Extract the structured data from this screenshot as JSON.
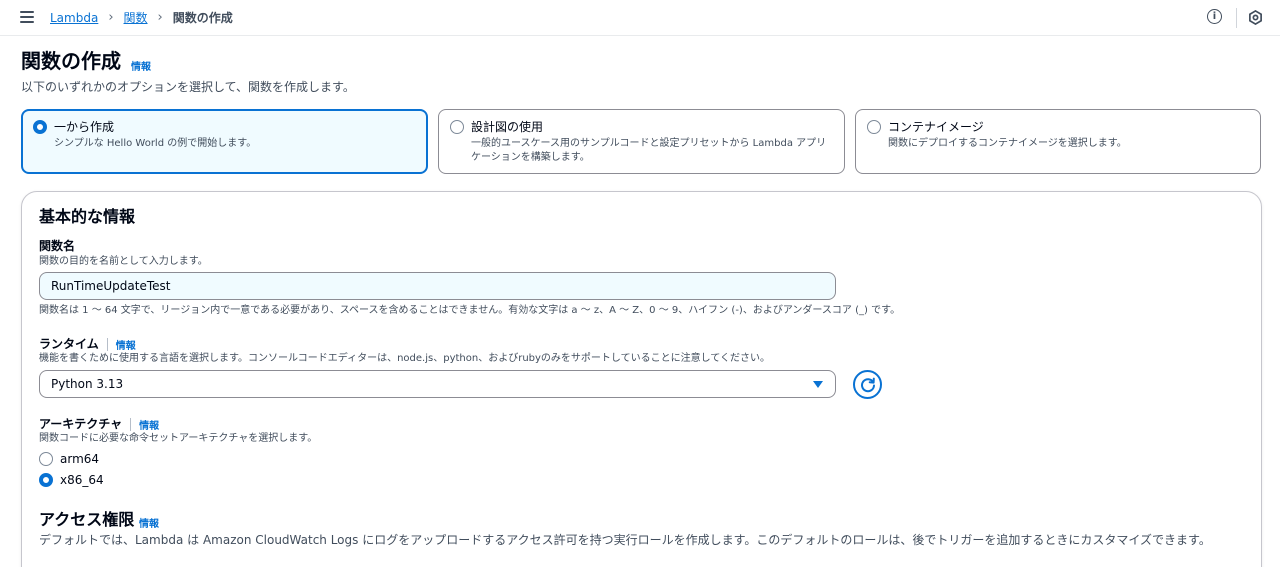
{
  "breadcrumb": {
    "items": [
      "Lambda",
      "関数"
    ],
    "current": "関数の作成"
  },
  "header": {
    "title": "関数の作成",
    "info": "情報",
    "description": "以下のいずれかのオプションを選択して、関数を作成します。"
  },
  "options": [
    {
      "title": "一から作成",
      "description": "シンプルな Hello World の例で開始します。",
      "selected": true
    },
    {
      "title": "設計図の使用",
      "description": "一般的ユースケース用のサンプルコードと設定プリセットから Lambda アプリケーションを構築します。",
      "selected": false
    },
    {
      "title": "コンテナイメージ",
      "description": "関数にデプロイするコンテナイメージを選択します。",
      "selected": false
    }
  ],
  "basic": {
    "title": "基本的な情報",
    "function_name": {
      "label": "関数名",
      "description": "関数の目的を名前として入力します。",
      "value": "RunTimeUpdateTest",
      "constraint": "関数名は 1 〜 64 文字で、リージョン内で一意である必要があり、スペースを含めることはできません。有効な文字は a 〜 z、A 〜 Z、0 〜 9、ハイフン (-)、およびアンダースコア (_) です。"
    },
    "runtime": {
      "label": "ランタイム",
      "info": "情報",
      "description": "機能を書くために使用する言語を選択します。コンソールコードエディターは、node.js、python、およびrubyのみをサポートしていることに注意してください。",
      "selected": "Python 3.13"
    },
    "architecture": {
      "label": "アーキテクチャ",
      "info": "情報",
      "description": "関数コードに必要な命令セットアーキテクチャを選択します。",
      "choices": [
        {
          "label": "arm64",
          "selected": false
        },
        {
          "label": "x86_64",
          "selected": true
        }
      ]
    },
    "access": {
      "title": "アクセス権限",
      "info": "情報",
      "description": "デフォルトでは、Lambda は Amazon CloudWatch Logs にログをアップロードするアクセス許可を持つ実行ロールを作成します。このデフォルトのロールは、後でトリガーを追加するときにカスタマイズできます。"
    }
  },
  "colors": {
    "link": "#0972d3",
    "selected_bg": "#f0fbff",
    "text": "#000716"
  }
}
